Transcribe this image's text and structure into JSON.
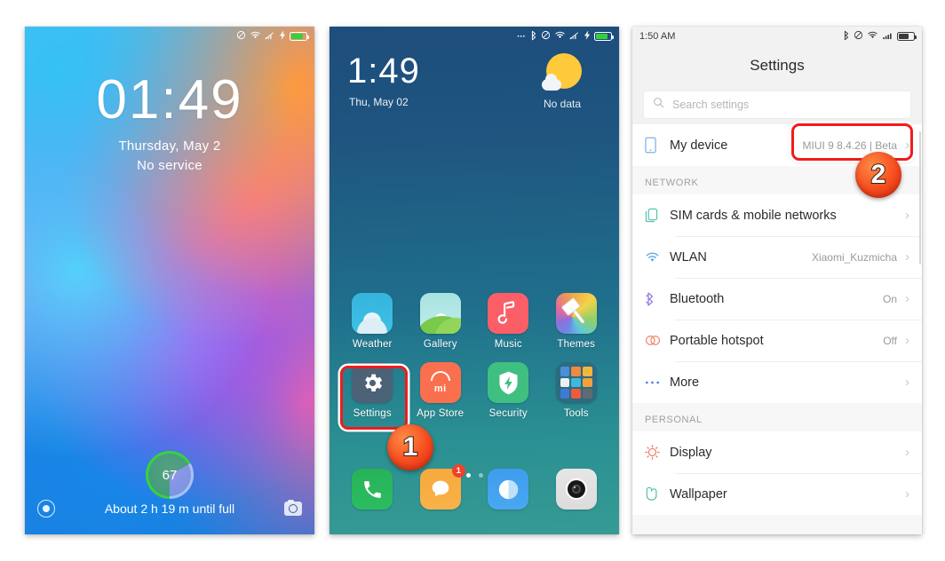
{
  "lockscreen": {
    "statusbar": {
      "icons": [
        "mute-icon",
        "wifi-icon",
        "signal-icon",
        "charging-bolt-icon",
        "battery-icon"
      ]
    },
    "time": "01:49",
    "date": "Thursday, May  2",
    "service": "No  service",
    "battery_percent": "67",
    "battery_message": "About 2 h 19 m until full",
    "left_shortcut": "unlock-icon",
    "right_shortcut": "camera-icon",
    "accent_green": "#3ad13a"
  },
  "homescreen": {
    "statusbar": {
      "icons": [
        "more-dots-icon",
        "bluetooth-icon",
        "mute-icon",
        "wifi-icon",
        "signal-icon",
        "charging-bolt-icon",
        "battery-icon"
      ]
    },
    "time": "1:49",
    "date": "Thu, May 02",
    "weather": {
      "label": "No data",
      "icon": "sun-cloud-icon"
    },
    "apps_row1": [
      {
        "label": "Weather",
        "icon": "weather-app-icon"
      },
      {
        "label": "Gallery",
        "icon": "gallery-app-icon"
      },
      {
        "label": "Music",
        "icon": "music-app-icon"
      },
      {
        "label": "Themes",
        "icon": "themes-app-icon"
      }
    ],
    "apps_row2": [
      {
        "label": "Settings",
        "icon": "settings-app-icon"
      },
      {
        "label": "App Store",
        "icon": "app-store-icon",
        "brand": "mi"
      },
      {
        "label": "Security",
        "icon": "security-app-icon"
      },
      {
        "label": "Tools",
        "icon": "tools-folder-icon"
      }
    ],
    "dock": [
      {
        "label": "phone",
        "icon": "phone-icon",
        "badge": ""
      },
      {
        "label": "messaging",
        "icon": "messaging-icon",
        "badge": "1"
      },
      {
        "label": "browser",
        "icon": "browser-icon",
        "badge": ""
      },
      {
        "label": "camera",
        "icon": "camera-icon",
        "badge": ""
      }
    ],
    "page_dots": 2,
    "active_dot": 1
  },
  "settings": {
    "statusbar_time": "1:50 AM",
    "statusbar": {
      "icons": [
        "bluetooth-icon",
        "mute-icon",
        "wifi-icon",
        "signal-icon",
        "battery-icon"
      ]
    },
    "title": "Settings",
    "search_placeholder": "Search settings",
    "my_device": {
      "label": "My device",
      "value": "MIUI 9 8.4.26 | Beta",
      "icon": "phone-device-icon"
    },
    "sections": [
      {
        "header": "NETWORK",
        "items": [
          {
            "label": "SIM cards & mobile networks",
            "value": "",
            "icon": "sim-card-icon",
            "color": "#4cc0ad"
          },
          {
            "label": "WLAN",
            "value": "Xiaomi_Kuzmicha",
            "icon": "wifi-icon",
            "color": "#56a9e8"
          },
          {
            "label": "Bluetooth",
            "value": "On",
            "icon": "bluetooth-icon",
            "color": "#9a7fe0"
          },
          {
            "label": "Portable hotspot",
            "value": "Off",
            "icon": "hotspot-icon",
            "color": "#f0836a"
          },
          {
            "label": "More",
            "value": "",
            "icon": "more-dots-icon",
            "color": "#5b8ae6"
          }
        ]
      },
      {
        "header": "PERSONAL",
        "items": [
          {
            "label": "Display",
            "value": "",
            "icon": "brightness-icon",
            "color": "#f4795e"
          },
          {
            "label": "Wallpaper",
            "value": "",
            "icon": "wallpaper-icon",
            "color": "#4cbba6"
          }
        ]
      }
    ],
    "chevron": "›"
  },
  "callouts": {
    "step1": "1",
    "step2": "2",
    "highlight_color": "#f01c1c"
  }
}
